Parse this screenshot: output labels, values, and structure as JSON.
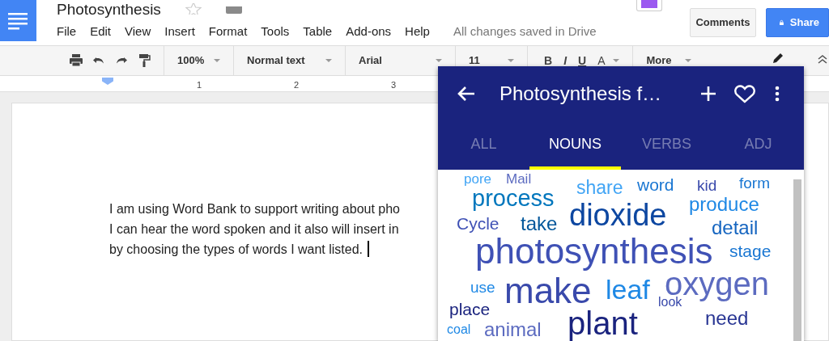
{
  "app": {
    "title": "Photosynthesis",
    "starred": false,
    "menu": [
      "File",
      "Edit",
      "View",
      "Insert",
      "Format",
      "Tools",
      "Table",
      "Add-ons",
      "Help"
    ],
    "save_status": "All changes saved in Drive",
    "buttons": [
      {
        "label": "Comments",
        "kind": "default"
      },
      {
        "label": "Share",
        "kind": "primary"
      }
    ]
  },
  "toolbar": {
    "zoom": "100%",
    "style": "Normal text",
    "font": "Arial",
    "size": "11",
    "format_buttons": [
      "B",
      "I",
      "U",
      "A"
    ],
    "more": "More"
  },
  "ruler": {
    "marks": [
      "1",
      "2",
      "3"
    ]
  },
  "document": {
    "lines": [
      "I am using Word Bank to support writing about pho",
      "I can hear the word spoken and it also will insert in",
      "by choosing the types of words I want listed."
    ]
  },
  "word_bank": {
    "title": "Photosynthesis f…",
    "tabs": [
      {
        "label": "ALL",
        "selected": false
      },
      {
        "label": "NOUNS",
        "selected": true
      },
      {
        "label": "VERBS",
        "selected": false
      },
      {
        "label": "ADJ",
        "selected": false
      }
    ],
    "words": [
      {
        "text": "pore",
        "color": "#42a5f5"
      },
      {
        "text": "Mail",
        "color": "#5c6bc0"
      },
      {
        "text": "process",
        "color": "#0277bd"
      },
      {
        "text": "share",
        "color": "#42a5f5"
      },
      {
        "text": "word",
        "color": "#1976d2"
      },
      {
        "text": "kid",
        "color": "#3949ab"
      },
      {
        "text": "form",
        "color": "#1976d2"
      },
      {
        "text": "Cycle",
        "color": "#3f51b5"
      },
      {
        "text": "take",
        "color": "#01579b"
      },
      {
        "text": "dioxide",
        "color": "#0d47a1"
      },
      {
        "text": "produce",
        "color": "#1e88e5"
      },
      {
        "text": "detail",
        "color": "#1565c0"
      },
      {
        "text": "photosynthesis",
        "color": "#3f51b5"
      },
      {
        "text": "stage",
        "color": "#1976d2"
      },
      {
        "text": "use",
        "color": "#1e88e5"
      },
      {
        "text": "make",
        "color": "#3949ab"
      },
      {
        "text": "leaf",
        "color": "#1e88e5"
      },
      {
        "text": "oxygen",
        "color": "#5c6bc0"
      },
      {
        "text": "look",
        "color": "#3949ab"
      },
      {
        "text": "place",
        "color": "#1a237e"
      },
      {
        "text": "coal",
        "color": "#1e88e5"
      },
      {
        "text": "animal",
        "color": "#5c6bc0"
      },
      {
        "text": "plant",
        "color": "#1a237e"
      },
      {
        "text": "need",
        "color": "#283593"
      }
    ]
  }
}
